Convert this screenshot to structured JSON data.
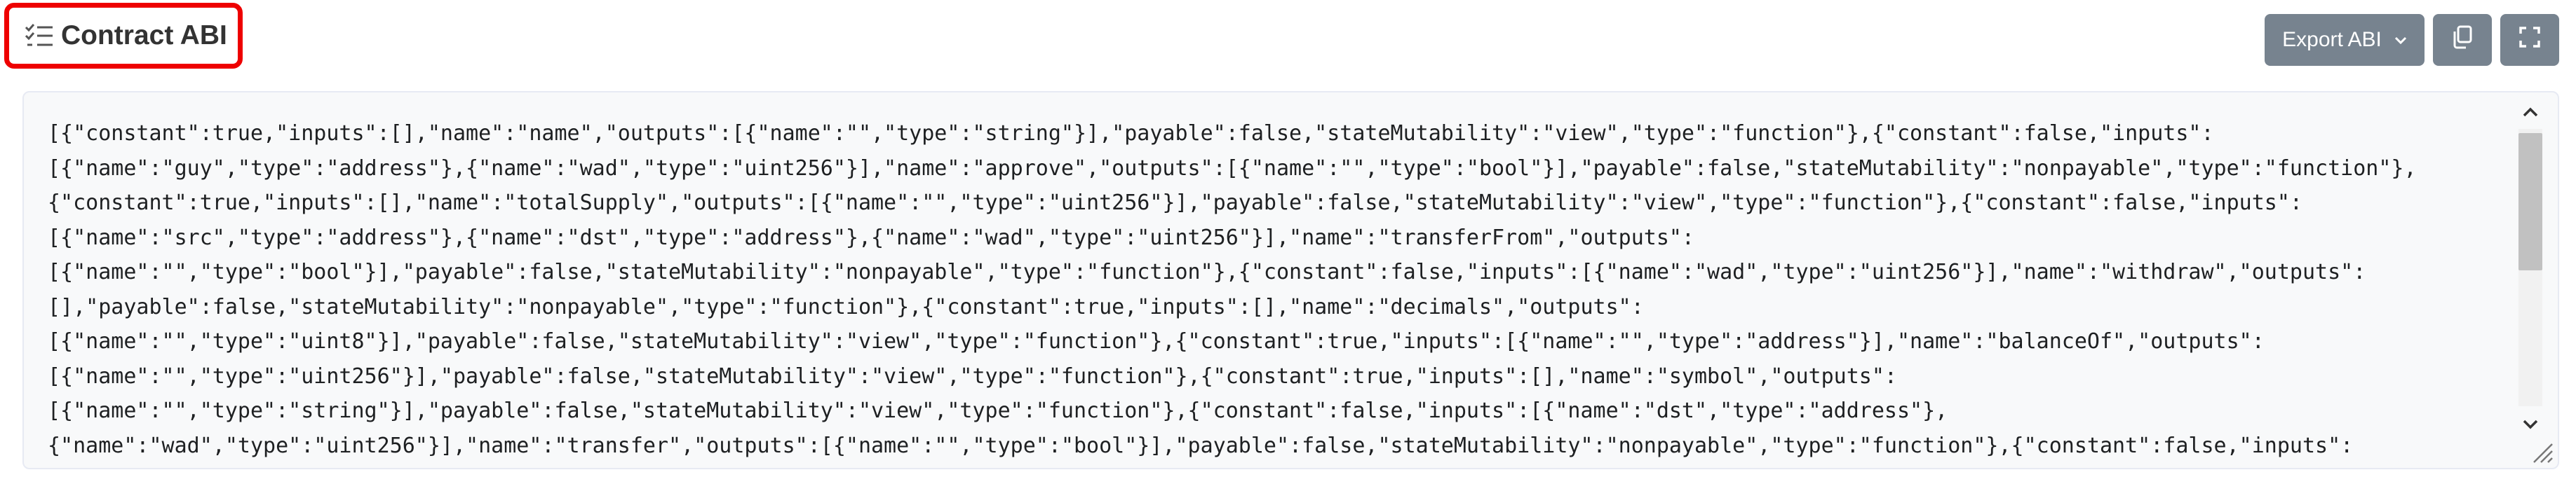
{
  "header": {
    "title": "Contract ABI",
    "title_icon": "checklist-icon"
  },
  "toolbar": {
    "export_label": "Export ABI",
    "export_icon": "chevron-down-icon",
    "copy_icon": "copy-icon",
    "fullscreen_icon": "fullscreen-icon"
  },
  "abi": {
    "lines": [
      "[{\"constant\":true,\"inputs\":[],\"name\":\"name\",\"outputs\":[{\"name\":\"\",\"type\":\"string\"}],\"payable\":false,\"stateMutability\":\"view\",\"type\":\"function\"},{\"constant\":false,\"inputs\":",
      "[{\"name\":\"guy\",\"type\":\"address\"},{\"name\":\"wad\",\"type\":\"uint256\"}],\"name\":\"approve\",\"outputs\":[{\"name\":\"\",\"type\":\"bool\"}],\"payable\":false,\"stateMutability\":\"nonpayable\",\"type\":\"function\"},",
      "{\"constant\":true,\"inputs\":[],\"name\":\"totalSupply\",\"outputs\":[{\"name\":\"\",\"type\":\"uint256\"}],\"payable\":false,\"stateMutability\":\"view\",\"type\":\"function\"},{\"constant\":false,\"inputs\":",
      "[{\"name\":\"src\",\"type\":\"address\"},{\"name\":\"dst\",\"type\":\"address\"},{\"name\":\"wad\",\"type\":\"uint256\"}],\"name\":\"transferFrom\",\"outputs\":",
      "[{\"name\":\"\",\"type\":\"bool\"}],\"payable\":false,\"stateMutability\":\"nonpayable\",\"type\":\"function\"},{\"constant\":false,\"inputs\":[{\"name\":\"wad\",\"type\":\"uint256\"}],\"name\":\"withdraw\",\"outputs\":",
      "[],\"payable\":false,\"stateMutability\":\"nonpayable\",\"type\":\"function\"},{\"constant\":true,\"inputs\":[],\"name\":\"decimals\",\"outputs\":",
      "[{\"name\":\"\",\"type\":\"uint8\"}],\"payable\":false,\"stateMutability\":\"view\",\"type\":\"function\"},{\"constant\":true,\"inputs\":[{\"name\":\"\",\"type\":\"address\"}],\"name\":\"balanceOf\",\"outputs\":",
      "[{\"name\":\"\",\"type\":\"uint256\"}],\"payable\":false,\"stateMutability\":\"view\",\"type\":\"function\"},{\"constant\":true,\"inputs\":[],\"name\":\"symbol\",\"outputs\":",
      "[{\"name\":\"\",\"type\":\"string\"}],\"payable\":false,\"stateMutability\":\"view\",\"type\":\"function\"},{\"constant\":false,\"inputs\":[{\"name\":\"dst\",\"type\":\"address\"},",
      "{\"name\":\"wad\",\"type\":\"uint256\"}],\"name\":\"transfer\",\"outputs\":[{\"name\":\"\",\"type\":\"bool\"}],\"payable\":false,\"stateMutability\":\"nonpayable\",\"type\":\"function\"},{\"constant\":false,\"inputs\":"
    ]
  },
  "scrollbar": {
    "up_icon": "scroll-up-arrow-icon",
    "down_icon": "scroll-down-arrow-icon"
  },
  "colors": {
    "highlight_border": "#ee0000",
    "button_bg": "#77838f",
    "code_bg": "#f8f9fa"
  }
}
